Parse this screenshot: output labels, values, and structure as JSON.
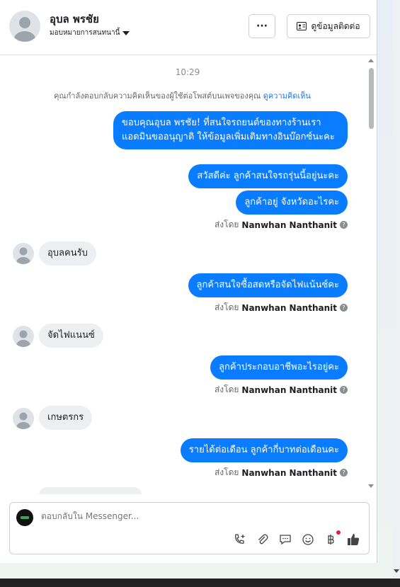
{
  "header": {
    "name": "อุบล พรชัย",
    "assign_label": "มอบหมายการสนทนานี้",
    "more_label": "···",
    "contact_label": "ดูข้อมูลติดต่อ"
  },
  "thread": {
    "time": "10:29",
    "notice_text": "คุณกำลังตอบกลับความคิดเห็นของผู้ใช้ต่อโพสต์บนเพจของคุณ",
    "notice_link": "ดูความคิดเห็น",
    "messages": [
      {
        "text": "ขอบคุณอุบล พรชัย! ที่สนใจรถยนต์ของทางร้านเรา แอดมินขออนุญาติ ให้ข้อมูลเพิ่มเติมทางอินบ๊อกซ์นะคะ"
      },
      {
        "text": "สวัสดีค่ะ ลูกค้าสนใจรถรุ่นนี้อยู่นะคะ"
      },
      {
        "text": "ลูกค้าอยู่  จังหวัดอะไรคะ"
      },
      {
        "text": "อุบลคนรับ"
      },
      {
        "text": "ลูกค้าสนใจซื้อสดหรือจัดไฟแน้นซ์คะ"
      },
      {
        "text": "จัดไฟแนนซ์"
      },
      {
        "text": "ลูกค้าประกอบอาชีพอะไรอยู่คะ"
      },
      {
        "text": "เกษตรกร"
      },
      {
        "text": "รายได้ต่อเดือน ลูกค้ากี่บาทต่อเดือนคะ"
      }
    ],
    "sent_prefix": "ส่งโดย",
    "sent_by": "Nanwhan Nanthanit"
  },
  "composer": {
    "placeholder": "ตอบกลับใน Messenger..."
  },
  "colors": {
    "outgoing": "#0a7cff",
    "incoming": "#eeeff1"
  }
}
